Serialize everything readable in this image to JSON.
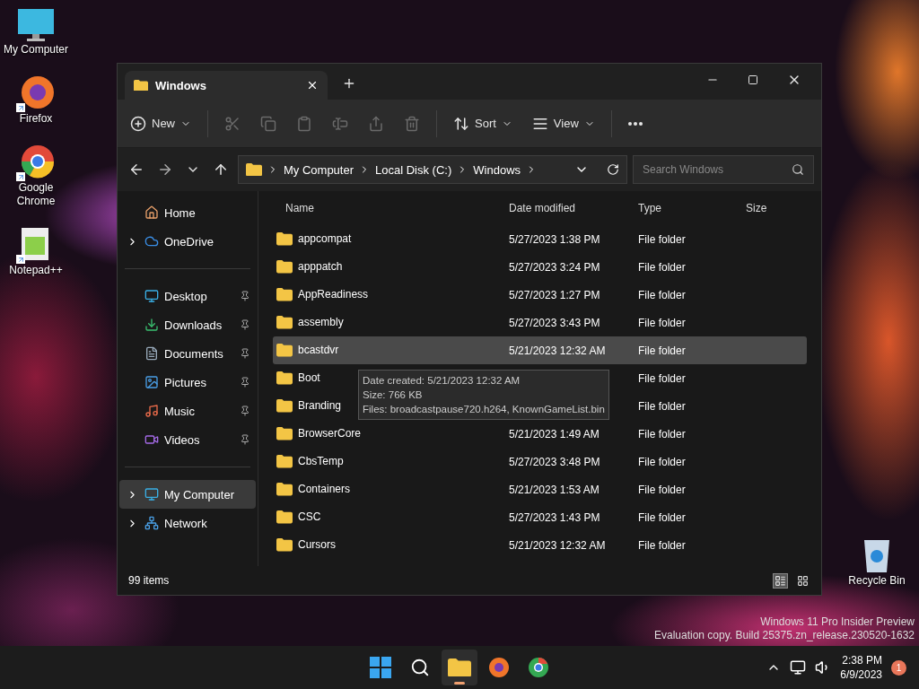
{
  "desktop_icons": [
    {
      "label": "My Computer",
      "shortcut": false
    },
    {
      "label": "Firefox",
      "shortcut": true
    },
    {
      "label": "Google Chrome",
      "shortcut": true
    },
    {
      "label": "Notepad++",
      "shortcut": true
    }
  ],
  "recycle_bin": {
    "label": "Recycle Bin"
  },
  "window": {
    "tabs": [
      {
        "label": "Windows",
        "selected": true
      }
    ],
    "toolbar": [
      {
        "label": "New",
        "dropdown": true,
        "disabled": false
      },
      {
        "disabled": true
      },
      {
        "disabled": true
      },
      {
        "disabled": true
      },
      {
        "disabled": true
      },
      {
        "disabled": true
      },
      {
        "disabled": true
      },
      {
        "label": "Sort",
        "dropdown": true,
        "disabled": false
      },
      {
        "label": "View",
        "dropdown": true,
        "disabled": false
      },
      {
        "disabled": false
      }
    ],
    "breadcrumb": [
      "My Computer",
      "Local Disk (C:)",
      "Windows"
    ],
    "search": {
      "placeholder": "Search Windows"
    },
    "sidebar": {
      "groups": [
        [
          {
            "label": "Home",
            "expandable": false,
            "pinned": false,
            "selected": false
          },
          {
            "label": "OneDrive",
            "expandable": true,
            "pinned": false,
            "selected": false
          }
        ],
        [
          {
            "label": "Desktop",
            "expandable": false,
            "pinned": true,
            "selected": false
          },
          {
            "label": "Downloads",
            "expandable": false,
            "pinned": true,
            "selected": false
          },
          {
            "label": "Documents",
            "expandable": false,
            "pinned": true,
            "selected": false
          },
          {
            "label": "Pictures",
            "expandable": false,
            "pinned": true,
            "selected": false
          },
          {
            "label": "Music",
            "expandable": false,
            "pinned": true,
            "selected": false
          },
          {
            "label": "Videos",
            "expandable": false,
            "pinned": true,
            "selected": false
          }
        ],
        [
          {
            "label": "My Computer",
            "expandable": true,
            "pinned": false,
            "selected": true
          },
          {
            "label": "Network",
            "expandable": true,
            "pinned": false,
            "selected": false
          }
        ]
      ]
    },
    "table": {
      "columns": [
        "Name",
        "Date modified",
        "Type",
        "Size"
      ],
      "rows": [
        {
          "name": "appcompat",
          "date": "5/27/2023 1:38 PM",
          "type": "File folder",
          "selected": false
        },
        {
          "name": "apppatch",
          "date": "5/27/2023 3:24 PM",
          "type": "File folder",
          "selected": false
        },
        {
          "name": "AppReadiness",
          "date": "5/27/2023 1:27 PM",
          "type": "File folder",
          "selected": false
        },
        {
          "name": "assembly",
          "date": "5/27/2023 3:43 PM",
          "type": "File folder",
          "selected": false
        },
        {
          "name": "bcastdvr",
          "date": "5/21/2023 12:32 AM",
          "type": "File folder",
          "selected": true
        },
        {
          "name": "Boot",
          "type": "File folder",
          "selected": false
        },
        {
          "name": "Branding",
          "type": "File folder",
          "selected": false
        },
        {
          "name": "BrowserCore",
          "date": "5/21/2023 1:49 AM",
          "type": "File folder",
          "selected": false
        },
        {
          "name": "CbsTemp",
          "date": "5/27/2023 3:48 PM",
          "type": "File folder",
          "selected": false
        },
        {
          "name": "Containers",
          "date": "5/21/2023 1:53 AM",
          "type": "File folder",
          "selected": false
        },
        {
          "name": "CSC",
          "date": "5/27/2023 1:43 PM",
          "type": "File folder",
          "selected": false
        },
        {
          "name": "Cursors",
          "date": "5/21/2023 12:32 AM",
          "type": "File folder",
          "selected": false
        }
      ]
    },
    "tooltip": [
      "Date created: 5/21/2023 12:32 AM",
      "Size: 766 KB",
      "Files: broadcastpause720.h264, KnownGameList.bin"
    ],
    "status_bar": {
      "count": "99 items",
      "views": [
        {
          "kind": "details",
          "selected": true
        },
        {
          "kind": "tiles",
          "selected": false
        }
      ]
    }
  },
  "watermark": [
    "Windows 11 Pro Insider Preview",
    "Evaluation copy. Build 25375.zn_release.230520-1632"
  ],
  "taskbar": {
    "apps": [
      {
        "kind": "start",
        "active": false
      },
      {
        "kind": "search",
        "active": false
      },
      {
        "kind": "explorer",
        "active": true
      },
      {
        "kind": "firefox",
        "active": false
      },
      {
        "kind": "chrome",
        "active": false
      }
    ],
    "time": "2:38 PM",
    "date": "6/9/2023",
    "notifications": "1"
  }
}
